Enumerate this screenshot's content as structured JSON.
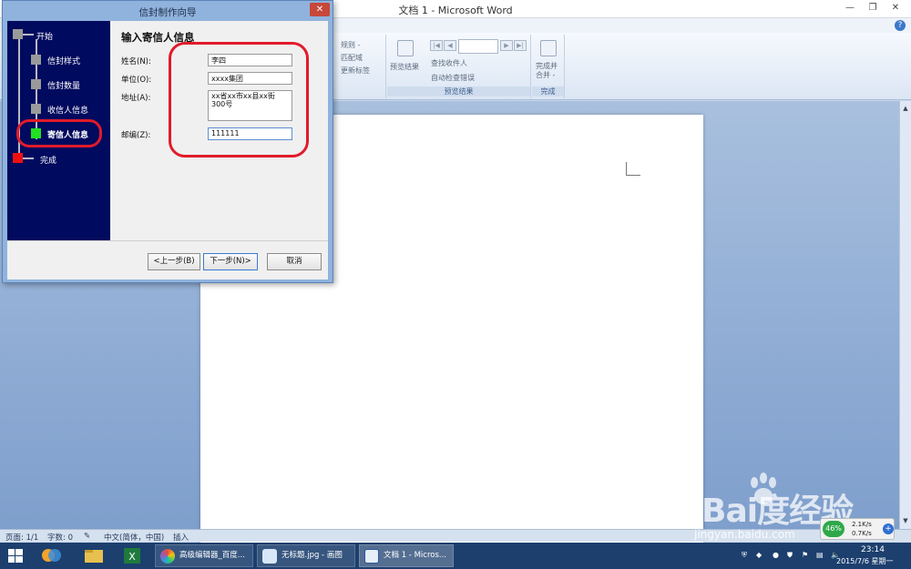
{
  "word": {
    "title": "文档 1 - Microsoft Word",
    "ribbon": {
      "items": {
        "rules": "规则 -",
        "match_fields": "匹配域",
        "update_labels": "更新标签",
        "preview_results": "预览结果",
        "find_recipient": "查找收件人",
        "auto_check_errors": "自动检查错误",
        "finish_merge": "完成并\n合并 -"
      },
      "groups": {
        "preview": "预览结果",
        "finish": "完成"
      },
      "record_value": ""
    },
    "status": {
      "page": "页面: 1/1",
      "words": "字数: 0",
      "language": "中文(简体，中国)",
      "mode": "插入"
    }
  },
  "dialog": {
    "title": "信封制作向导",
    "steps": [
      {
        "label": "开始",
        "color": "#9a9a9a"
      },
      {
        "label": "信封样式",
        "color": "#9a9a9a"
      },
      {
        "label": "信封数量",
        "color": "#9a9a9a"
      },
      {
        "label": "收信人信息",
        "color": "#9a9a9a"
      },
      {
        "label": "寄信人信息",
        "color": "#22e022"
      },
      {
        "label": "完成",
        "color": "#ee1010"
      }
    ],
    "form_title": "输入寄信人信息",
    "fields": {
      "name": {
        "label": "姓名(N):",
        "value": "李四"
      },
      "unit": {
        "label": "单位(O):",
        "value": "xxxx集团"
      },
      "address": {
        "label": "地址(A):",
        "value": "xx省xx市xx县xx街300号"
      },
      "zip": {
        "label": "邮编(Z):",
        "value": "111111"
      }
    },
    "buttons": {
      "back": "<上一步(B)",
      "next": "下一步(N)>",
      "cancel": "取消"
    }
  },
  "taskbar": {
    "tasks": [
      {
        "label": "高级编辑器_百度..."
      },
      {
        "label": "无标题.jpg - 画图"
      },
      {
        "label": "文档 1 - Micros..."
      }
    ],
    "tray": {
      "time": "23:14",
      "date": "2015/7/6 星期一"
    },
    "net": {
      "percent": "46%",
      "up": "2.1K/s",
      "down": "0.7K/s"
    }
  },
  "watermark": {
    "logo": "Bai度经验",
    "url": "jingyan.baidu.com"
  },
  "colors": {
    "accent": "#2b579a",
    "highlight": "#e11b2a",
    "steps_bg": "#000a5e"
  }
}
